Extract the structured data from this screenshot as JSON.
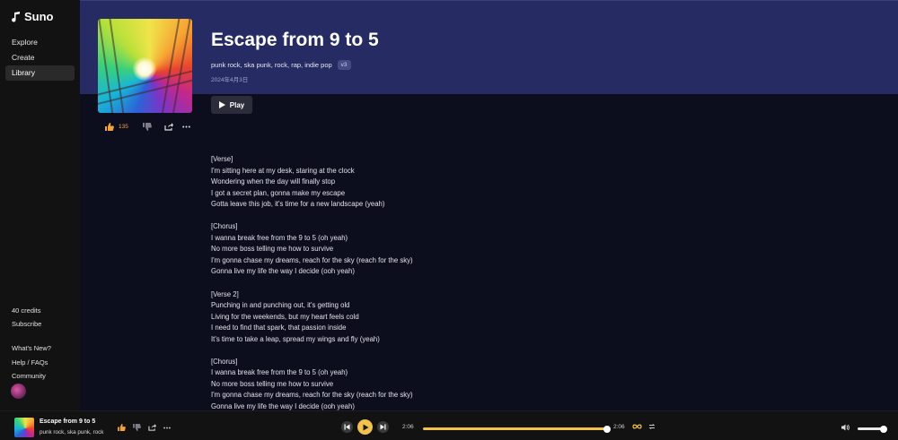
{
  "sidebar": {
    "logo": "Suno",
    "nav": [
      {
        "label": "Explore"
      },
      {
        "label": "Create"
      },
      {
        "label": "Library",
        "active": true
      }
    ],
    "credits": "40 credits",
    "subscribe": "Subscribe",
    "whats_new": "What's New?",
    "help": "Help / FAQs",
    "community": "Community"
  },
  "song": {
    "title": "Escape from 9 to 5",
    "tags": "punk rock, ska punk, rock, rap, indie pop",
    "version": "v3",
    "date": "2024年4月3日",
    "play_label": "Play",
    "like_count": "135",
    "lyrics": "[Verse]\nI'm sitting here at my desk, staring at the clock\nWondering when the day will finally stop\nI got a secret plan, gonna make my escape\nGotta leave this job, it's time for a new landscape (yeah)\n\n[Chorus]\nI wanna break free from the 9 to 5 (oh yeah)\nNo more boss telling me how to survive\nI'm gonna chase my dreams, reach for the sky (reach for the sky)\nGonna live my life the way I decide (ooh yeah)\n\n[Verse 2]\nPunching in and punching out, it's getting old\nLiving for the weekends, but my heart feels cold\nI need to find that spark, that passion inside\nIt's time to take a leap, spread my wings and fly (yeah)\n\n[Chorus]\nI wanna break free from the 9 to 5 (oh yeah)\nNo more boss telling me how to survive\nI'm gonna chase my dreams, reach for the sky (reach for the sky)\nGonna live my life the way I decide (ooh yeah)"
  },
  "player": {
    "title": "Escape from 9 to 5",
    "tags": "punk rock, ska punk, rock",
    "current_time": "2:06",
    "total_time": "2:06",
    "progress": 1.0,
    "volume": 0.95,
    "accent": "#f2c14e"
  },
  "colors": {
    "hero": "#262b63",
    "background": "#0d0e1d",
    "sidebar": "#121212",
    "like": "#f2a33a"
  },
  "icons": [
    "thumbs-up-icon",
    "thumbs-down-icon",
    "share-icon",
    "more-icon",
    "play-icon",
    "previous-icon",
    "next-icon",
    "loop-icon",
    "shuffle-icon",
    "volume-icon"
  ]
}
